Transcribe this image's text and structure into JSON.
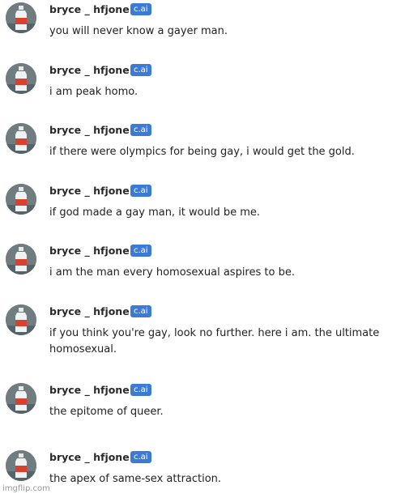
{
  "messages": [
    {
      "author": "bryce _ hfjone",
      "badge": "c.ai",
      "text": "you will never know a gayer man."
    },
    {
      "author": "bryce _ hfjone",
      "badge": "c.ai",
      "text": "i am peak homo."
    },
    {
      "author": "bryce _ hfjone",
      "badge": "c.ai",
      "text": "if there were olympics for being gay, i would get the gold."
    },
    {
      "author": "bryce _ hfjone",
      "badge": "c.ai",
      "text": "if god made a gay man, it would be me."
    },
    {
      "author": "bryce _ hfjone",
      "badge": "c.ai",
      "text": "i am the man every homosexual aspires to be."
    },
    {
      "author": "bryce _ hfjone",
      "badge": "c.ai",
      "text": "if you think you're gay, look no further. here i am. the ultimate homosexual."
    },
    {
      "author": "bryce _ hfjone",
      "badge": "c.ai",
      "text": "the epitome of queer."
    },
    {
      "author": "bryce _ hfjone",
      "badge": "c.ai",
      "text": "the apex of same-sex attraction."
    }
  ],
  "watermark": "imgflip.com",
  "colors": {
    "badge": "#3b7bd6",
    "avatar_bg": "#6c7a7f",
    "bottle_label": "#d8412f"
  },
  "avatar_icon": "bottle-avatar-icon"
}
